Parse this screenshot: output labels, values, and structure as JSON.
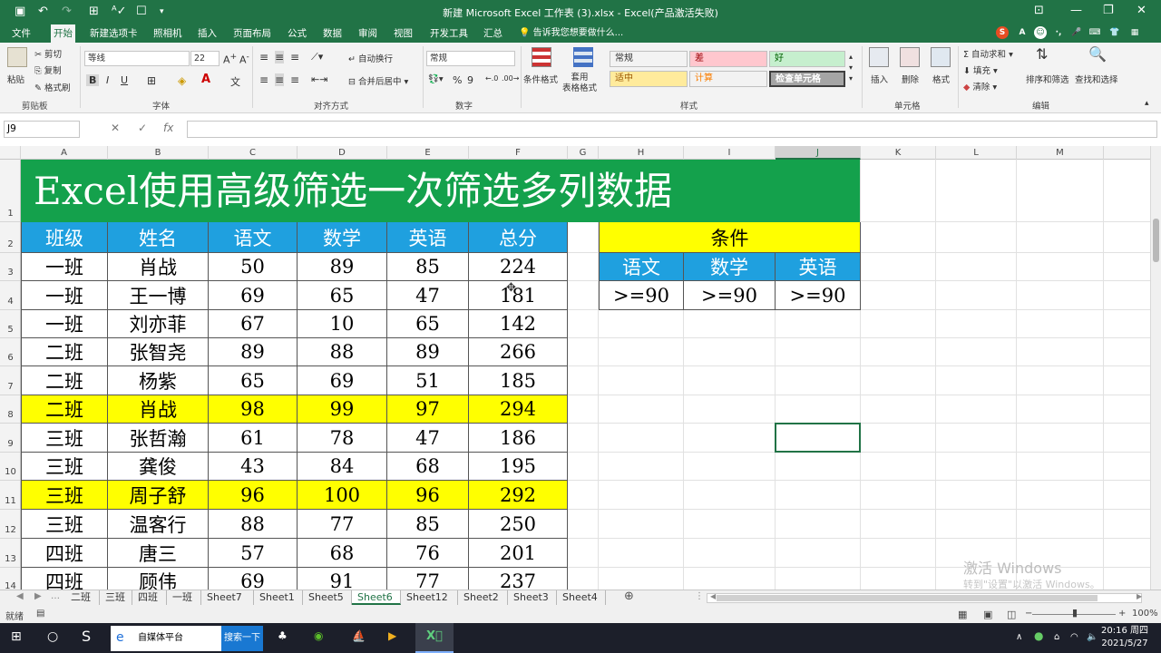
{
  "window": {
    "title": "新建 Microsoft Excel 工作表 (3).xlsx - Excel(产品激活失败)",
    "quick_access": [
      "save",
      "undo",
      "redo",
      "touch-mode",
      "spell-check",
      "form",
      "customize"
    ],
    "controls": [
      "ribbon-display",
      "minimize",
      "maximize",
      "close"
    ]
  },
  "ribbon_tabs": [
    "文件",
    "开始",
    "新建选项卡",
    "照相机",
    "插入",
    "页面布局",
    "公式",
    "数据",
    "审阅",
    "视图",
    "开发工具",
    "汇总"
  ],
  "active_tab": "开始",
  "tell_me": "告诉我您想要做什么...",
  "ribbon": {
    "clipboard": {
      "paste": "粘贴",
      "cut": "剪切",
      "copy": "复制",
      "format_painter": "格式刷",
      "label": "剪贴板"
    },
    "font": {
      "name": "等线",
      "size": "22",
      "bold": "B",
      "italic": "I",
      "underline": "U",
      "label": "字体"
    },
    "alignment": {
      "wrap": "自动换行",
      "merge": "合并后居中",
      "label": "对齐方式"
    },
    "number": {
      "format": "常规",
      "percent": "%",
      "comma": "9",
      "label": "数字"
    },
    "styles": {
      "conditional": "条件格式",
      "table_format": "套用\n表格格式",
      "cells": [
        {
          "text": "常规",
          "bg": "#ffffff",
          "color": "#333333"
        },
        {
          "text": "差",
          "bg": "#ffc7ce",
          "color": "#9c0006"
        },
        {
          "text": "好",
          "bg": "#c6efce",
          "color": "#006100"
        },
        {
          "text": "适中",
          "bg": "#ffeb9c",
          "color": "#9c5700"
        },
        {
          "text": "计算",
          "bg": "#f2f2f2",
          "color": "#fa7d00"
        },
        {
          "text": "检查单元格",
          "bg": "#a5a5a5",
          "color": "#ffffff"
        }
      ],
      "label": "样式"
    },
    "cells_group": {
      "insert": "插入",
      "delete": "删除",
      "format": "格式",
      "label": "单元格"
    },
    "editing": {
      "autosum": "自动求和",
      "fill": "填充",
      "clear": "清除",
      "sort": "排序和筛选",
      "find": "查找和选择",
      "label": "编辑"
    }
  },
  "formula_bar": {
    "name_box": "J9",
    "cancel": "✕",
    "enter": "✓",
    "fx": "fx",
    "content": ""
  },
  "columns": [
    "A",
    "B",
    "C",
    "D",
    "E",
    "F",
    "G",
    "H",
    "I",
    "J",
    "K",
    "L",
    "M"
  ],
  "rows": [
    "1",
    "2",
    "3",
    "4",
    "5",
    "6",
    "7",
    "8",
    "9",
    "10",
    "11",
    "12",
    "13",
    "14"
  ],
  "sheet": {
    "title": "Excel使用高级筛选一次筛选多列数据",
    "headers": [
      "班级",
      "姓名",
      "语文",
      "数学",
      "英语",
      "总分"
    ],
    "data": [
      [
        "一班",
        "肖战",
        "50",
        "89",
        "85",
        "224"
      ],
      [
        "一班",
        "王一博",
        "69",
        "65",
        "47",
        "181"
      ],
      [
        "一班",
        "刘亦菲",
        "67",
        "10",
        "65",
        "142"
      ],
      [
        "二班",
        "张智尧",
        "89",
        "88",
        "89",
        "266"
      ],
      [
        "二班",
        "杨紫",
        "65",
        "69",
        "51",
        "185"
      ],
      [
        "二班",
        "肖战",
        "98",
        "99",
        "97",
        "294"
      ],
      [
        "三班",
        "张哲瀚",
        "61",
        "78",
        "47",
        "186"
      ],
      [
        "三班",
        "龚俊",
        "43",
        "84",
        "68",
        "195"
      ],
      [
        "三班",
        "周子舒",
        "96",
        "100",
        "96",
        "292"
      ],
      [
        "三班",
        "温客行",
        "88",
        "77",
        "85",
        "250"
      ],
      [
        "四班",
        "唐三",
        "57",
        "68",
        "76",
        "201"
      ],
      [
        "四班",
        "顾伟",
        "69",
        "91",
        "77",
        "237"
      ]
    ],
    "highlighted_rows": [
      5,
      8
    ],
    "criteria": {
      "title": "条件",
      "headers": [
        "语文",
        "数学",
        "英语"
      ],
      "values": [
        ">=90",
        ">=90",
        ">=90"
      ]
    },
    "colors": {
      "title_bg": "#14a14c",
      "header_bg": "#1fa0df",
      "highlight": "#ffff00",
      "criteria_title_bg": "#ffff00"
    }
  },
  "sheet_tabs": [
    "二班",
    "三班",
    "四班",
    "一班",
    "Sheet7",
    "Sheet1",
    "Sheet5",
    "Sheet6",
    "Sheet12",
    "Sheet2",
    "Sheet3",
    "Sheet4"
  ],
  "active_sheet": "Sheet6",
  "status": {
    "mode": "就绪",
    "zoom": "100%"
  },
  "watermark": {
    "line1": "激活 Windows",
    "line2": "转到\"设置\"以激活 Windows。"
  },
  "taskbar": {
    "browser_text": "自媒体平台",
    "search_button": "搜索一下",
    "time": "20:16 周四",
    "date": "2021/5/27",
    "ime": "A"
  }
}
